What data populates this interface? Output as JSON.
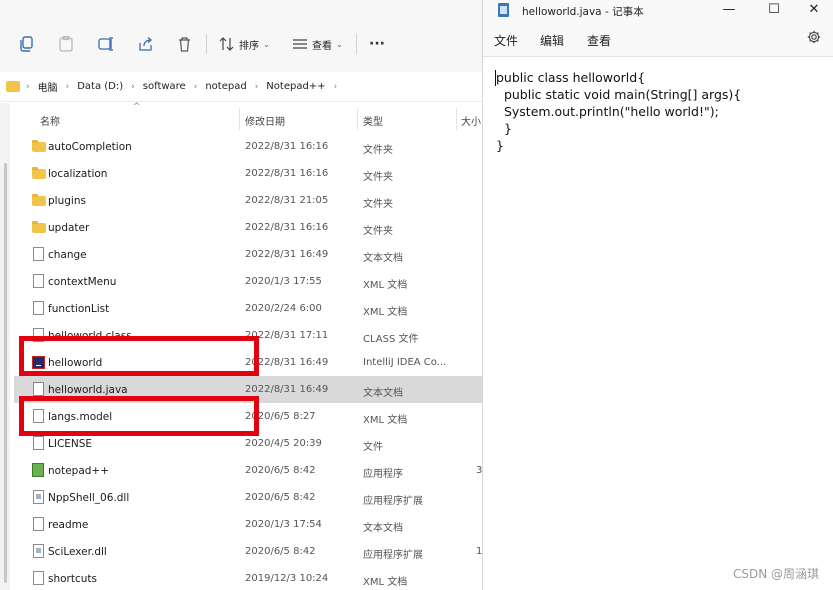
{
  "explorer": {
    "toolbar": {
      "sort_label": "排序",
      "view_label": "查看",
      "more_label": "···"
    },
    "breadcrumb": [
      "电脑",
      "Data (D:)",
      "software",
      "notepad",
      "Notepad++"
    ],
    "columns": {
      "name": "名称",
      "date": "修改日期",
      "type": "类型",
      "size": "大小"
    },
    "files": [
      {
        "name": "autoCompletion",
        "date": "2022/8/31 16:16",
        "type": "文件夹",
        "size": "",
        "icon": "folder-icon"
      },
      {
        "name": "localization",
        "date": "2022/8/31 16:16",
        "type": "文件夹",
        "size": "",
        "icon": "folder-icon"
      },
      {
        "name": "plugins",
        "date": "2022/8/31 21:05",
        "type": "文件夹",
        "size": "",
        "icon": "folder-icon"
      },
      {
        "name": "updater",
        "date": "2022/8/31 16:16",
        "type": "文件夹",
        "size": "",
        "icon": "folder-icon"
      },
      {
        "name": "change",
        "date": "2022/8/31 16:49",
        "type": "文本文档",
        "size": "",
        "icon": "file-icon"
      },
      {
        "name": "contextMenu",
        "date": "2020/1/3 17:55",
        "type": "XML 文档",
        "size": "",
        "icon": "file-icon"
      },
      {
        "name": "functionList",
        "date": "2020/2/24 6:00",
        "type": "XML 文档",
        "size": "",
        "icon": "file-icon"
      },
      {
        "name": "helloworld.class",
        "date": "2022/8/31 17:11",
        "type": "CLASS 文件",
        "size": "",
        "icon": "file-icon"
      },
      {
        "name": "helloworld",
        "date": "2022/8/31 16:49",
        "type": "IntelliJ IDEA Co...",
        "size": "",
        "icon": "intellij-icon"
      },
      {
        "name": "helloworld.java",
        "date": "2022/8/31 16:49",
        "type": "文本文档",
        "size": "",
        "icon": "file-icon",
        "selected": true
      },
      {
        "name": "langs.model",
        "date": "2020/6/5 8:27",
        "type": "XML 文档",
        "size": "",
        "icon": "file-icon"
      },
      {
        "name": "LICENSE",
        "date": "2020/4/5 20:39",
        "type": "文件",
        "size": "",
        "icon": "file-icon"
      },
      {
        "name": "notepad++",
        "date": "2020/6/5 8:42",
        "type": "应用程序",
        "size": "3",
        "icon": "notepadpp-icon"
      },
      {
        "name": "NppShell_06.dll",
        "date": "2020/6/5 8:42",
        "type": "应用程序扩展",
        "size": "",
        "icon": "dll-icon"
      },
      {
        "name": "readme",
        "date": "2020/1/3 17:54",
        "type": "文本文档",
        "size": "",
        "icon": "file-icon"
      },
      {
        "name": "SciLexer.dll",
        "date": "2020/6/5 8:42",
        "type": "应用程序扩展",
        "size": "1",
        "icon": "dll-icon"
      },
      {
        "name": "shortcuts",
        "date": "2019/12/3 10:24",
        "type": "XML 文档",
        "size": "",
        "icon": "file-icon"
      }
    ]
  },
  "notepad": {
    "title": "helloworld.java - 记事本",
    "window_controls": {
      "minimize": "—",
      "maximize": "☐",
      "close": "✕"
    },
    "menu": [
      "文件",
      "编辑",
      "查看"
    ],
    "content_lines": [
      "public class helloworld{",
      "  public static void main(String[] args){",
      "  System.out.println(\"hello world!\");",
      "  }",
      "}"
    ]
  },
  "watermark": "CSDN @周涵琪",
  "colors": {
    "highlight_box": "#e3000f",
    "selected_row": "#d9d9d9",
    "folder": "#f2c54a"
  }
}
